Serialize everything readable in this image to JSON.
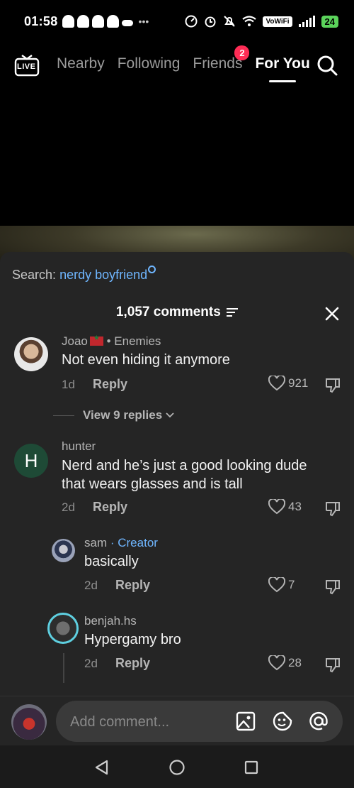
{
  "status": {
    "time": "01:58",
    "wifi_label": "VoWiFi",
    "battery": "24"
  },
  "nav": {
    "tabs": [
      {
        "label": "Nearby"
      },
      {
        "label": "Following"
      },
      {
        "label": "Friends",
        "badge": "2"
      },
      {
        "label": "For You",
        "active": true
      }
    ],
    "live_label": "LIVE"
  },
  "sheet": {
    "search_prefix": "Search:",
    "search_term": "nerdy boyfriend",
    "count_title": "1,057 comments",
    "view_replies": "View 9 replies"
  },
  "comments": [
    {
      "user": "Joao",
      "tag": "• Enemies",
      "text": "Not even hiding it anymore",
      "age": "1d",
      "reply": "Reply",
      "likes": "921"
    },
    {
      "user": "hunter",
      "initial": "H",
      "text_1": "Nerd and he’s just a good looking dude",
      "text_2": "that wears glasses and is tall",
      "age": "2d",
      "reply": "Reply",
      "likes": "43"
    },
    {
      "user": "sam",
      "creator": "· Creator",
      "text": "basically",
      "age": "2d",
      "reply": "Reply",
      "likes": "7"
    },
    {
      "user": "benjah.hs",
      "text": "Hypergamy bro",
      "age": "2d",
      "reply": "Reply",
      "likes": "28"
    }
  ],
  "composer": {
    "placeholder": "Add comment..."
  },
  "colors": {
    "accent_link": "#6fb6ff",
    "badge": "#fe2c55",
    "sheet_bg": "#252525",
    "battery": "#5bd35b"
  }
}
